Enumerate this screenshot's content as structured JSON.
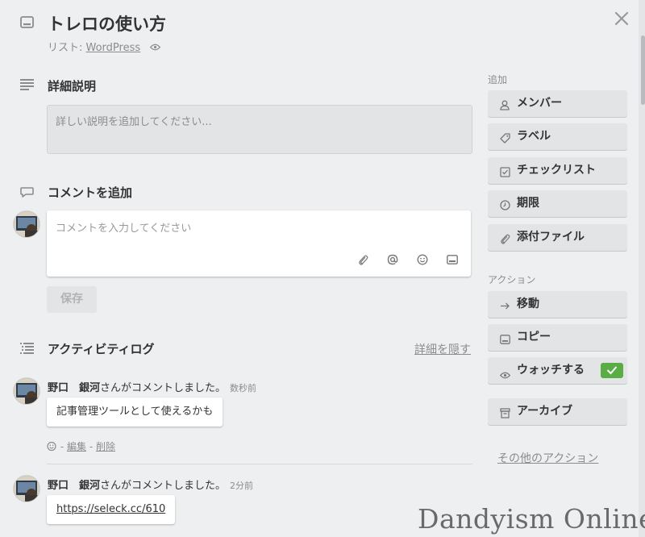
{
  "card": {
    "title": "トレロの使い方",
    "list_prefix": "リスト: ",
    "list_name": "WordPress"
  },
  "description": {
    "heading": "詳細説明",
    "placeholder": "詳しい説明を追加してください..."
  },
  "comment": {
    "heading": "コメントを追加",
    "placeholder": "コメントを入力してください",
    "save_label": "保存"
  },
  "activity": {
    "heading": "アクティビティログ",
    "toggle_label": "詳細を隠す",
    "entries": [
      {
        "user": "野口　銀河",
        "action": "さんがコメントしました。",
        "time": "数秒前",
        "text": "記事管理ツールとして使えるかも",
        "edit_label": "編集",
        "delete_label": "削除",
        "separator": "-"
      },
      {
        "user": "野口　銀河",
        "action": "さんがコメントしました。",
        "time": "2分前",
        "text": "https://seleck.cc/610"
      }
    ]
  },
  "sidebar": {
    "add_heading": "追加",
    "add_buttons": [
      {
        "label": "メンバー",
        "icon": "person-icon"
      },
      {
        "label": "ラベル",
        "icon": "tag-icon"
      },
      {
        "label": "チェックリスト",
        "icon": "checkbox-icon"
      },
      {
        "label": "期限",
        "icon": "clock-icon"
      },
      {
        "label": "添付ファイル",
        "icon": "paperclip-icon"
      }
    ],
    "actions_heading": "アクション",
    "action_buttons": [
      {
        "label": "移動",
        "icon": "arrow-right-icon"
      },
      {
        "label": "コピー",
        "icon": "card-icon"
      },
      {
        "label": "ウォッチする",
        "icon": "eye-icon",
        "checked": true
      },
      {
        "label": "アーカイブ",
        "icon": "archive-icon"
      }
    ],
    "more_actions": "その他のアクション"
  },
  "watermark": "Dandyism Online",
  "colors": {
    "background": "#edeff0",
    "button": "#e2e4e6",
    "check_green": "#5aac44",
    "muted_text": "#8c8c8c"
  }
}
